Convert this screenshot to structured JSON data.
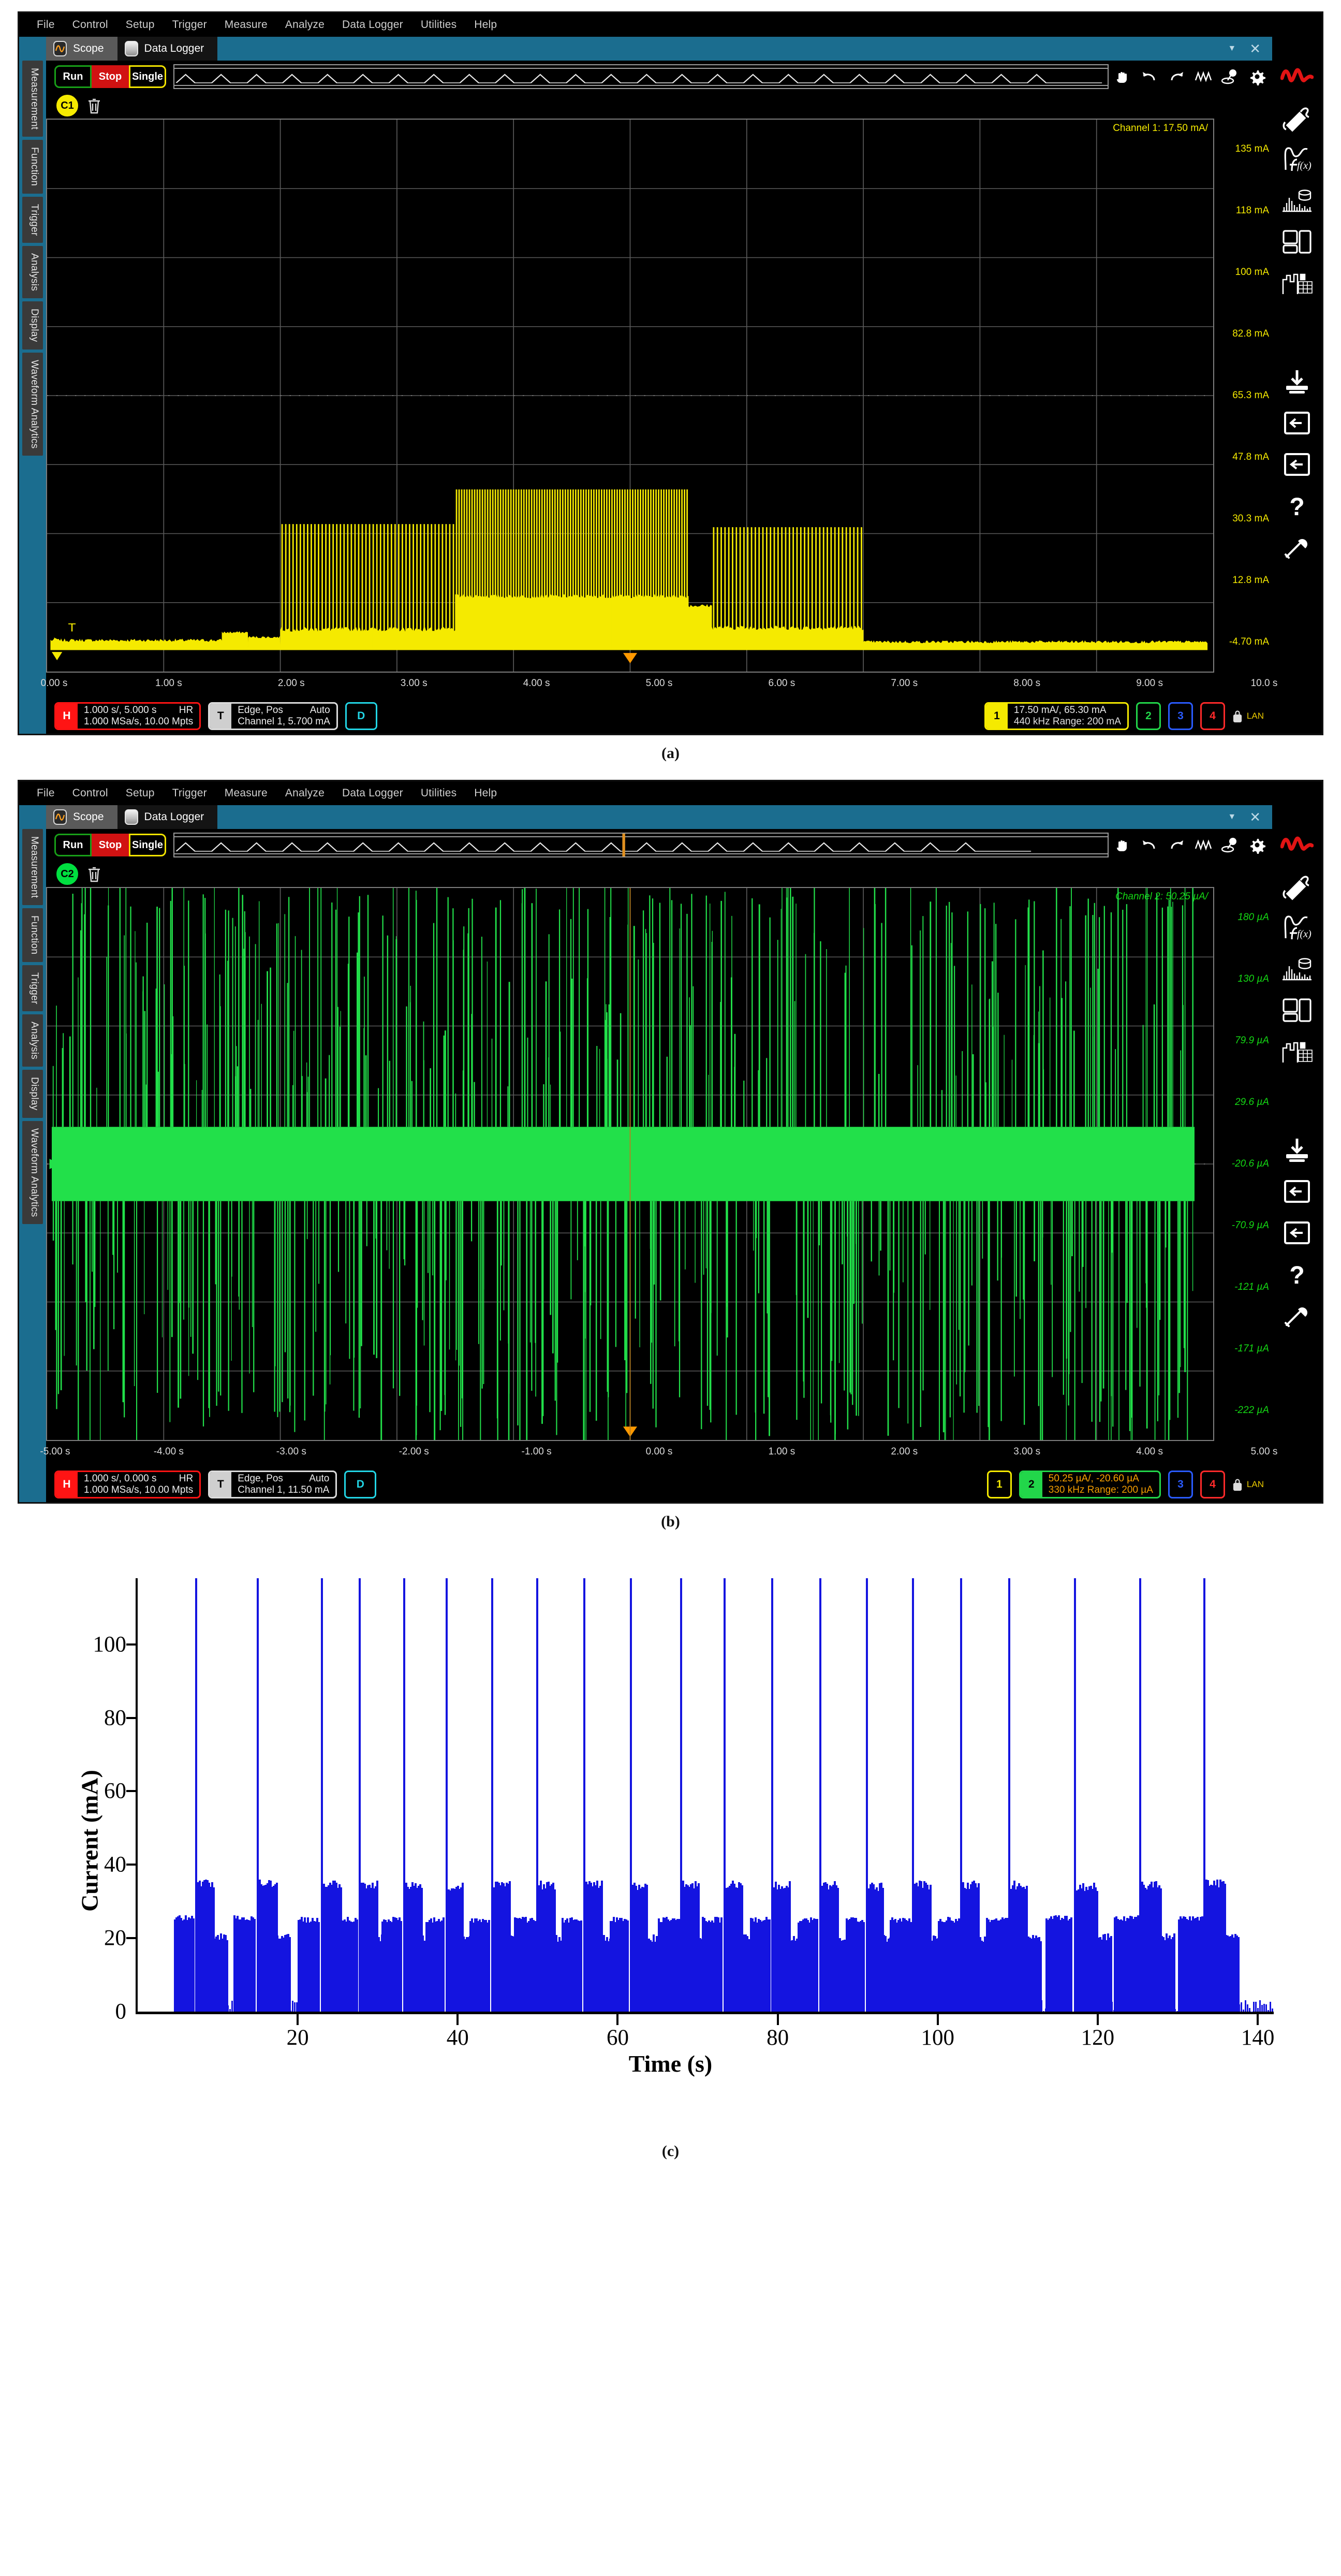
{
  "menu": {
    "items": [
      "File",
      "Control",
      "Setup",
      "Trigger",
      "Measure",
      "Analyze",
      "Data Logger",
      "Utilities",
      "Help"
    ]
  },
  "left_rail": {
    "tabs": [
      "Measurement",
      "Function",
      "Trigger",
      "Analysis",
      "Display",
      "Waveform Analytics"
    ]
  },
  "tabs": {
    "scope": "Scope",
    "data_logger": "Data Logger"
  },
  "acq_buttons": {
    "run": "Run",
    "stop": "Stop",
    "single": "Single"
  },
  "panel_a": {
    "caption": "(a)",
    "channel_bubble": "C1",
    "channel_note": "Channel 1: 17.50 mA/",
    "y_ticks": [
      "135 mA",
      "118 mA",
      "100 mA",
      "82.8 mA",
      "65.3 mA",
      "47.8 mA",
      "30.3 mA",
      "12.8 mA",
      "-4.70 mA"
    ],
    "x_ticks": [
      "0.00 s",
      "1.00 s",
      "2.00 s",
      "3.00 s",
      "4.00 s",
      "5.00 s",
      "6.00 s",
      "7.00 s",
      "8.00 s",
      "9.00 s",
      "10.0 s"
    ],
    "trigger_marker": "T",
    "status": {
      "horizontal": {
        "tag": "H",
        "line1_left": "1.000 s/, 5.000 s",
        "line1_right": "HR",
        "line2": "1.000 MSa/s, 10.00 Mpts"
      },
      "trigger": {
        "tag": "T",
        "line1_left": "Edge, Pos",
        "line1_right": "Auto",
        "line2": "Channel 1, 5.700 mA"
      },
      "digital": {
        "tag": "D"
      },
      "channels": [
        {
          "num": "1",
          "active": true,
          "line1": "17.50 mA/, 65.30 mA",
          "line2": "440 kHz  Range: 200 mA"
        },
        {
          "num": "2",
          "active": false,
          "line1": "",
          "line2": ""
        },
        {
          "num": "3",
          "active": false,
          "line1": "",
          "line2": ""
        },
        {
          "num": "4",
          "active": false,
          "line1": "",
          "line2": ""
        }
      ],
      "lan": "LAN"
    }
  },
  "panel_b": {
    "caption": "(b)",
    "channel_bubble": "C2",
    "channel_note": "Channel 2:  50.25 µA/",
    "y_ticks": [
      "180 µA",
      "130 µA",
      "79.9 µA",
      "29.6 µA",
      "-20.6 µA",
      "-70.9 µA",
      "-121 µA",
      "-171 µA",
      "-222 µA"
    ],
    "x_ticks": [
      "-5.00 s",
      "-4.00 s",
      "-3.00 s",
      "-2.00 s",
      "-1.00 s",
      "0.00 s",
      "1.00 s",
      "2.00 s",
      "3.00 s",
      "4.00 s",
      "5.00 s"
    ],
    "status": {
      "horizontal": {
        "tag": "H",
        "line1_left": "1.000 s/, 0.000 s",
        "line1_right": "HR",
        "line2": "1.000 MSa/s, 10.00 Mpts"
      },
      "trigger": {
        "tag": "T",
        "line1_left": "Edge, Pos",
        "line1_right": "Auto",
        "line2": "Channel 1, 11.50 mA"
      },
      "digital": {
        "tag": "D"
      },
      "channels": [
        {
          "num": "1",
          "active": false,
          "line1": "",
          "line2": ""
        },
        {
          "num": "2",
          "active": true,
          "line1": "50.25 µA/, -20.60 µA",
          "line2": "330 kHz   Range: 200 µA"
        },
        {
          "num": "3",
          "active": false,
          "line1": "",
          "line2": ""
        },
        {
          "num": "4",
          "active": false,
          "line1": "",
          "line2": ""
        }
      ],
      "lan": "LAN"
    }
  },
  "panel_c": {
    "caption": "(c)"
  },
  "chart_data": {
    "type": "bar",
    "title": "",
    "xlabel": "Time (s)",
    "ylabel": "Current (mA)",
    "xlim": [
      0,
      142
    ],
    "ylim": [
      0,
      118
    ],
    "x_ticks": [
      20,
      40,
      60,
      80,
      100,
      120,
      140
    ],
    "y_ticks": [
      0,
      20,
      40,
      60,
      80,
      100
    ],
    "grid": false,
    "legend": null,
    "series_color": "#1414e0",
    "description": "Periodic current bursts: ~25 mA baseline burst followed by ~35 mA burst, each cycle topped by a narrow spike exceeding 115 mA.",
    "bursts": [
      {
        "start": 4.5,
        "spike_t": 7.2,
        "low_level": 25.5,
        "high_level": 35.0,
        "spike": 118
      },
      {
        "start": 12.0,
        "spike_t": 14.9,
        "low_level": 25.5,
        "high_level": 35.0,
        "spike": 118
      },
      {
        "start": 20.0,
        "spike_t": 22.9,
        "low_level": 25.0,
        "high_level": 34.5,
        "spike": 118
      },
      {
        "start": 25.0,
        "spike_t": 27.6,
        "low_level": 25.0,
        "high_level": 34.5,
        "spike": 118
      },
      {
        "start": 30.5,
        "spike_t": 33.2,
        "low_level": 25.0,
        "high_level": 34.5,
        "spike": 118
      },
      {
        "start": 36.0,
        "spike_t": 38.5,
        "low_level": 25.0,
        "high_level": 34.0,
        "spike": 118
      },
      {
        "start": 41.5,
        "spike_t": 44.2,
        "low_level": 25.0,
        "high_level": 34.5,
        "spike": 118
      },
      {
        "start": 47.0,
        "spike_t": 49.8,
        "low_level": 25.0,
        "high_level": 34.5,
        "spike": 118
      },
      {
        "start": 53.0,
        "spike_t": 55.7,
        "low_level": 25.0,
        "high_level": 34.5,
        "spike": 118
      },
      {
        "start": 59.0,
        "spike_t": 61.5,
        "low_level": 25.0,
        "high_level": 34.0,
        "spike": 118
      },
      {
        "start": 65.0,
        "spike_t": 67.8,
        "low_level": 25.0,
        "high_level": 34.5,
        "spike": 118
      },
      {
        "start": 70.5,
        "spike_t": 73.2,
        "low_level": 25.0,
        "high_level": 34.5,
        "spike": 118
      },
      {
        "start": 76.5,
        "spike_t": 79.2,
        "low_level": 25.0,
        "high_level": 34.5,
        "spike": 118
      },
      {
        "start": 82.5,
        "spike_t": 85.2,
        "low_level": 25.0,
        "high_level": 34.5,
        "spike": 118
      },
      {
        "start": 88.5,
        "spike_t": 91.0,
        "low_level": 25.0,
        "high_level": 34.0,
        "spike": 118
      },
      {
        "start": 94.0,
        "spike_t": 96.8,
        "low_level": 25.0,
        "high_level": 34.5,
        "spike": 118
      },
      {
        "start": 100.0,
        "spike_t": 102.8,
        "low_level": 25.0,
        "high_level": 34.5,
        "spike": 118
      },
      {
        "start": 106.0,
        "spike_t": 108.8,
        "low_level": 25.0,
        "high_level": 34.5,
        "spike": 118
      },
      {
        "start": 113.5,
        "spike_t": 117.0,
        "low_level": 25.5,
        "high_level": 34.0,
        "spike": 118
      },
      {
        "start": 122.0,
        "spike_t": 125.2,
        "low_level": 25.5,
        "high_level": 34.5,
        "spike": 118
      },
      {
        "start": 130.0,
        "spike_t": 133.2,
        "low_level": 25.5,
        "high_level": 35.0,
        "spike": 118
      }
    ]
  }
}
